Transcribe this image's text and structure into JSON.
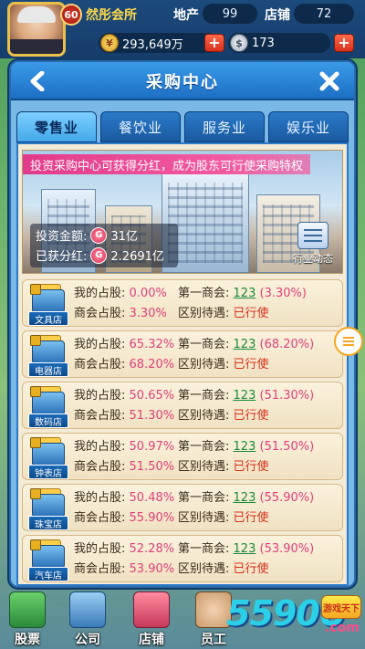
{
  "player": {
    "level": "60",
    "name": "然彤会所",
    "stats": [
      {
        "label": "地产",
        "value": "99"
      },
      {
        "label": "店铺",
        "value": "72"
      }
    ],
    "money": "293,649万",
    "money_icon": "coin-icon",
    "diamonds": "173",
    "diamond_icon": "silver-icon",
    "plus_label": "+"
  },
  "modal": {
    "title": "采购中心",
    "back_icon": "chevron-left-icon",
    "close_icon": "close-x-icon",
    "tabs": [
      {
        "label": "零售业",
        "active": true
      },
      {
        "label": "餐饮业",
        "active": false
      },
      {
        "label": "服务业",
        "active": false
      },
      {
        "label": "娱乐业",
        "active": false
      }
    ],
    "banner": {
      "promo_text": "投资采购中心可获得分红，成为股东可行使采购特权",
      "invest_label": "投资金额:",
      "invest_value": "31亿",
      "dividend_label": "已获分红:",
      "dividend_value": "2.2691亿",
      "currency_glyph": "G",
      "industry_news_label": "行业动态"
    },
    "row_labels": {
      "my_share": "我的占股:",
      "first_chamber": "第一商会:",
      "chamber_share": "商会占股:",
      "treatment": "区别待遇:"
    },
    "shops": [
      {
        "name": "文具店",
        "my_share": "0.00%",
        "first_id": "123",
        "first_pct": "(3.30%)",
        "chamber_share": "3.30%",
        "treatment": "已行使"
      },
      {
        "name": "电器店",
        "my_share": "65.32%",
        "first_id": "123",
        "first_pct": "(68.20%)",
        "chamber_share": "68.20%",
        "treatment": "已行使"
      },
      {
        "name": "数码店",
        "my_share": "50.65%",
        "first_id": "123",
        "first_pct": "(51.30%)",
        "chamber_share": "51.30%",
        "treatment": "已行使"
      },
      {
        "name": "钟表店",
        "my_share": "50.97%",
        "first_id": "123",
        "first_pct": "(51.50%)",
        "chamber_share": "51.50%",
        "treatment": "已行使"
      },
      {
        "name": "珠宝店",
        "my_share": "50.48%",
        "first_id": "123",
        "first_pct": "(55.90%)",
        "chamber_share": "55.90%",
        "treatment": "已行使"
      },
      {
        "name": "汽车店",
        "my_share": "52.28%",
        "first_id": "123",
        "first_pct": "(53.90%)",
        "chamber_share": "53.90%",
        "treatment": "已行使"
      }
    ]
  },
  "bottom_nav": [
    {
      "label": "股票",
      "icon": "stocks-icon"
    },
    {
      "label": "公司",
      "icon": "company-icon"
    },
    {
      "label": "店铺",
      "icon": "shop-icon"
    },
    {
      "label": "员工",
      "icon": "staff-icon"
    }
  ],
  "watermark": {
    "text": "5590U",
    "suffix": ".com",
    "tag": "游戏天下"
  },
  "colors": {
    "accent_blue": "#1d6fc4",
    "active_tab": "#45a8ea",
    "promo_pink": "#e23a8a",
    "value_pink": "#e0407a",
    "link_green": "#1a8a3a",
    "status_red": "#d8301a",
    "panel_bg": "#f4ebd6"
  }
}
